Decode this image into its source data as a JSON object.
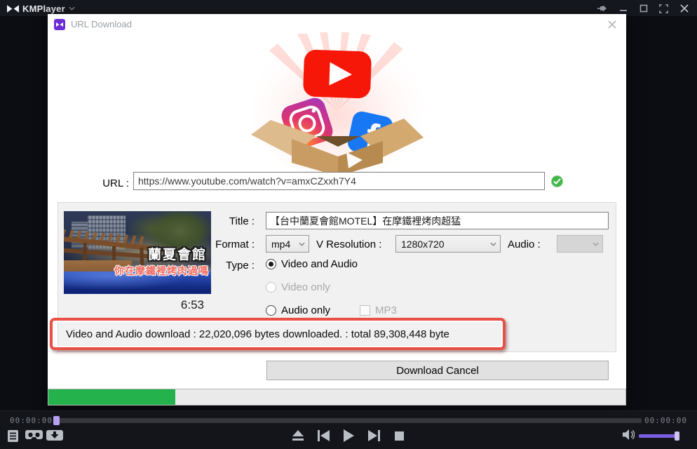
{
  "titlebar": {
    "app_name": "KMPlayer"
  },
  "dialog": {
    "title": "URL Download",
    "url": {
      "label": "URL :",
      "value": "https://www.youtube.com/watch?v=amxCZxxh7Y4"
    },
    "video": {
      "title_label": "Title :",
      "title_value": "【台中蘭夏會館MOTEL】在摩鐵裡烤肉超猛",
      "format_label": "Format :",
      "format_value": "mp4",
      "resolution_label": "V Resolution :",
      "resolution_value": "1280x720",
      "audio_label": "Audio :",
      "audio_value": "",
      "type_label": "Type :",
      "type_options": [
        {
          "label": "Video and Audio",
          "selected": true,
          "disabled": false
        },
        {
          "label": "Video only",
          "selected": false,
          "disabled": true
        },
        {
          "label": "Audio only",
          "selected": false,
          "disabled": false
        }
      ],
      "mp3_label": "MP3",
      "duration": "6:53",
      "thumbnail_line1": "蘭夏會館",
      "thumbnail_line2": "你在摩鐵裡烤肉過嗎"
    },
    "status_text": "Video and Audio download : 22,020,096 bytes downloaded. : total 89,308,448 byte",
    "download_cancel_label": "Download Cancel",
    "progress_percent": 22
  },
  "player": {
    "time_elapsed": "00:00:00",
    "time_total": "00:00:00",
    "volume_percent": 95
  },
  "colors": {
    "accent_purple": "#6e2ed6",
    "progress_green": "#23b24b",
    "annotation_red": "#e94f44",
    "check_green": "#43b649",
    "youtube_red": "#f61708",
    "facebook_blue": "#1877f2",
    "volume_purple": "#7b5fe0"
  }
}
